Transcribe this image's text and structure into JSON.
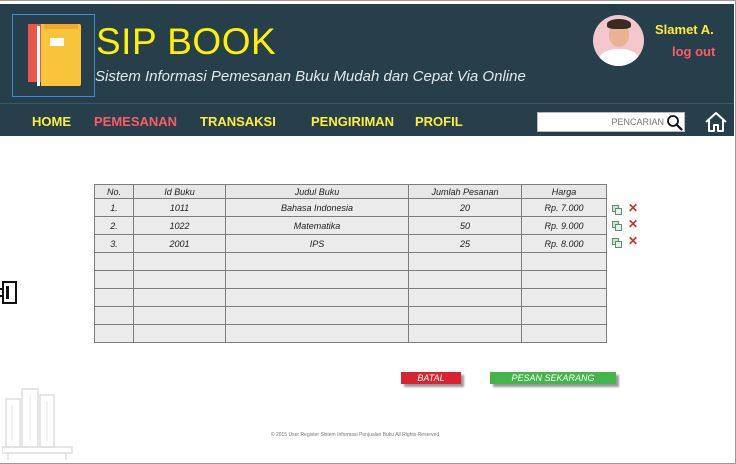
{
  "header": {
    "title": "SIP BOOK",
    "subtitle": "Sistem Informasi Pemesanan Buku Mudah dan Cepat Via Online",
    "user_name": "Slamet A.",
    "logout_label": "log out"
  },
  "nav": {
    "items": [
      {
        "label": "HOME",
        "active": false
      },
      {
        "label": "PEMESANAN",
        "active": true
      },
      {
        "label": "TRANSAKSI",
        "active": false
      },
      {
        "label": "PENGIRIMAN",
        "active": false
      },
      {
        "label": "PROFIL",
        "active": false
      }
    ],
    "search_placeholder": "PENCARIAN",
    "icons": {
      "search": "search-icon",
      "home": "home-icon"
    }
  },
  "table": {
    "headers": [
      "No.",
      "Id Buku",
      "Judul Buku",
      "Jumlah Pesanan",
      "Harga"
    ],
    "rows": [
      [
        "1.",
        "1011",
        "Bahasa Indonesia",
        "20",
        "Rp. 7.000"
      ],
      [
        "2.",
        "1022",
        "Matematika",
        "50",
        "Rp. 9.000"
      ],
      [
        "3.",
        "2001",
        "IPS",
        "25",
        "Rp. 8.000"
      ],
      [
        "",
        "",
        "",
        "",
        ""
      ],
      [
        "",
        "",
        "",
        "",
        ""
      ],
      [
        "",
        "",
        "",
        "",
        ""
      ],
      [
        "",
        "",
        "",
        "",
        ""
      ],
      [
        "",
        "",
        "",
        "",
        ""
      ]
    ],
    "row_action_icons": [
      "copy-icon",
      "delete-icon"
    ],
    "delete_glyph": "✕"
  },
  "actions": {
    "cancel_label": "BATAL",
    "order_label": "PESAN SEKARANG"
  },
  "colors": {
    "header_bg": "#263f4b",
    "accent_yellow": "#fff200",
    "accent_red": "#ff5b66",
    "cancel_button": "#d9232f",
    "order_button": "#43b549"
  },
  "footer": {
    "text": "© 2015 User Register Sistem Informasi Penjualan Buku All Rights Reserved"
  }
}
